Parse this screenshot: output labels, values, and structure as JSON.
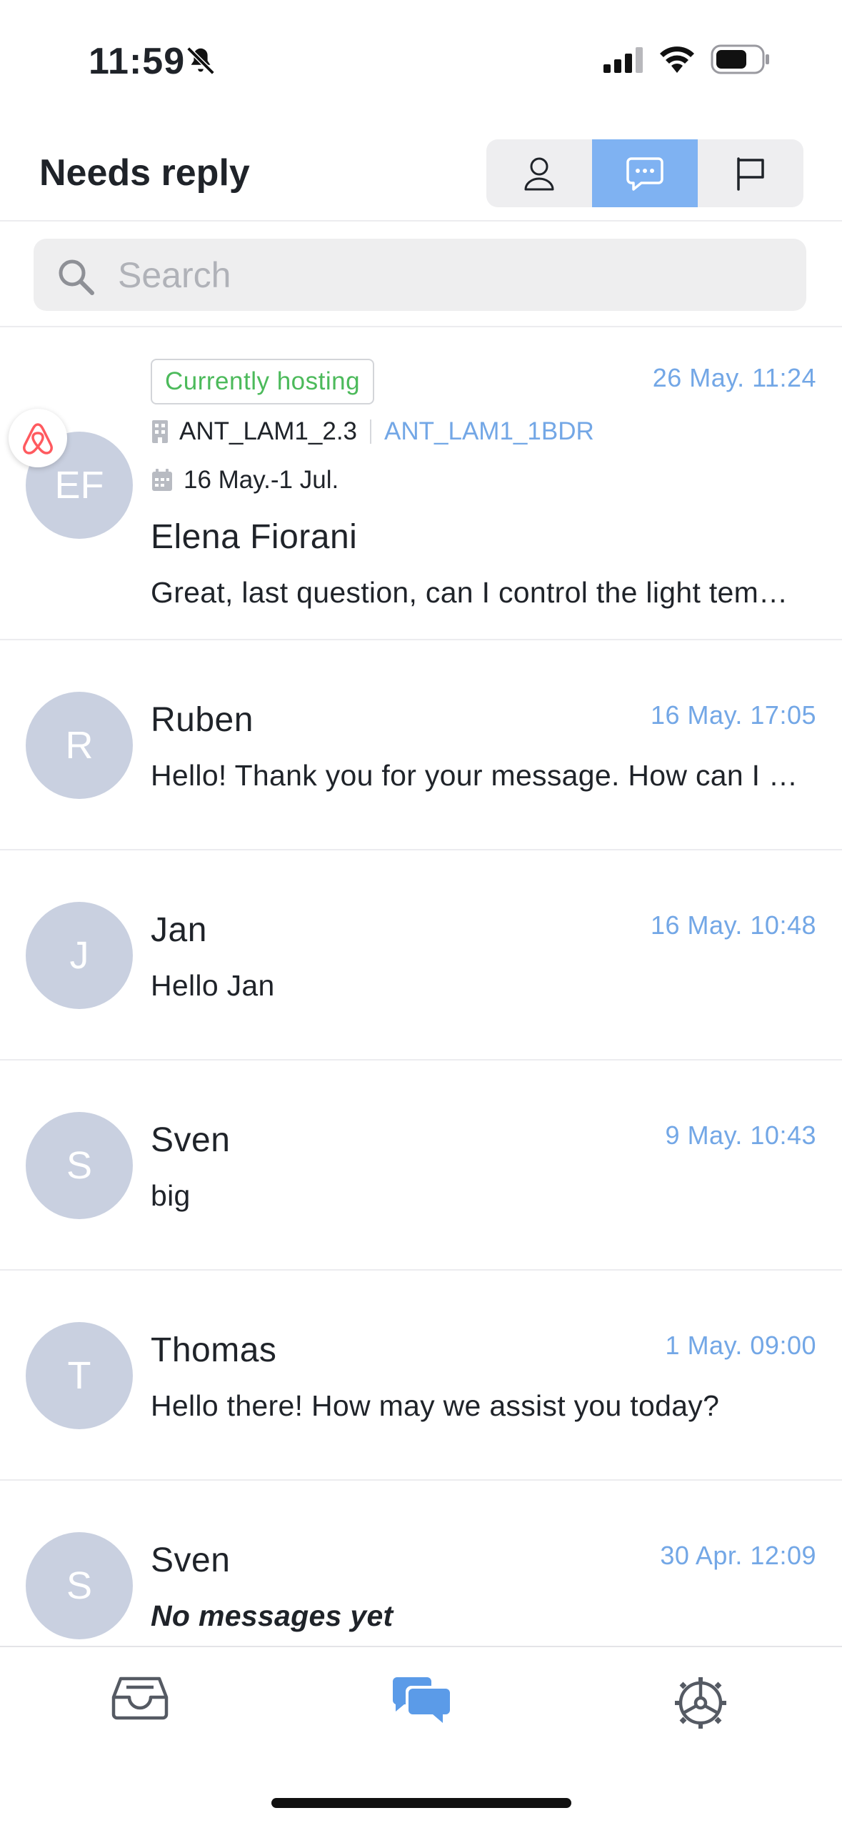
{
  "status_bar": {
    "time": "11:59"
  },
  "header": {
    "title": "Needs reply",
    "active_filter": "messages"
  },
  "search": {
    "placeholder": "Search",
    "value": ""
  },
  "conversations": [
    {
      "initials": "EF",
      "name": "Elena Fiorani",
      "date": "26 May. 11:24",
      "message": "Great, last question, can I control the light temperature?",
      "badge": "Currently hosting",
      "listing_id": "ANT_LAM1_2.3",
      "listing_name": "ANT_LAM1_1BDR",
      "dates": "16 May.-1 Jul.",
      "channel": "airbnb"
    },
    {
      "initials": "R",
      "name": "Ruben",
      "date": "16 May. 17:05",
      "message": "Hello! Thank you for your message. How can I help you?"
    },
    {
      "initials": "J",
      "name": "Jan",
      "date": "16 May. 10:48",
      "message": "Hello Jan"
    },
    {
      "initials": "S",
      "name": "Sven",
      "date": "9 May. 10:43",
      "message": "big"
    },
    {
      "initials": "T",
      "name": "Thomas",
      "date": "1 May. 09:00",
      "message": "Hello there! How may we assist you today?"
    },
    {
      "initials": "S",
      "name": "Sven",
      "date": "30 Apr. 12:09",
      "message": "No messages yet"
    }
  ],
  "tabbar": {
    "active": "messages"
  },
  "colors": {
    "accent": "#73a7e6",
    "active_segment": "#7fb2f2",
    "badge_text": "#4cba5b",
    "avatar_bg": "#c9d0e0",
    "airbnb": "#ff5a5f"
  }
}
